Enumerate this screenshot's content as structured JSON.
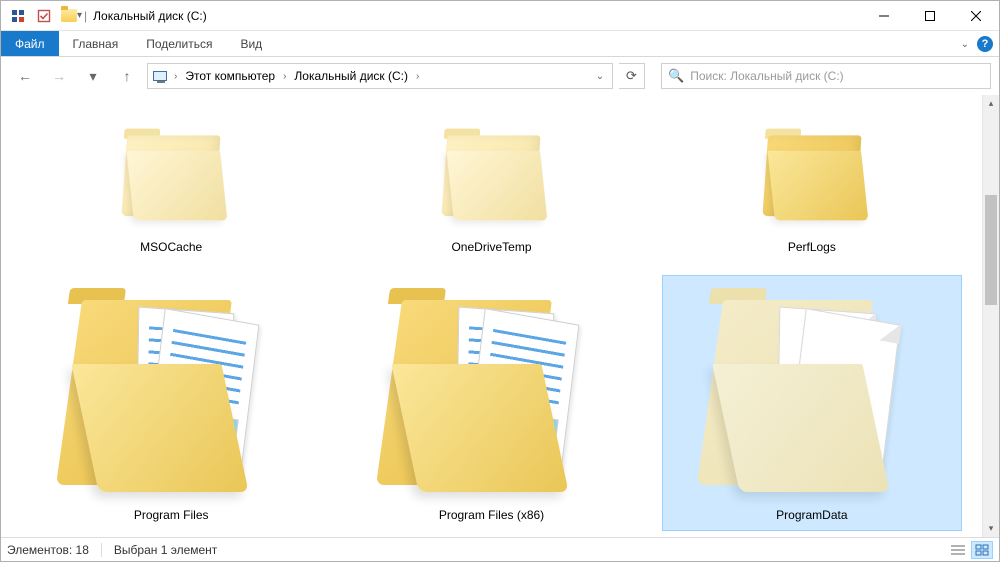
{
  "title": "Локальный диск (C:)",
  "ribbon": {
    "file": "Файл",
    "tabs": [
      "Главная",
      "Поделиться",
      "Вид"
    ]
  },
  "breadcrumb": {
    "root": "Этот компьютер",
    "current": "Локальный диск (C:)"
  },
  "search": {
    "placeholder": "Поиск: Локальный диск (C:)"
  },
  "items": [
    {
      "name": "MSOCache",
      "kind": "empty",
      "selected": false
    },
    {
      "name": "OneDriveTemp",
      "kind": "empty",
      "selected": false
    },
    {
      "name": "PerfLogs",
      "kind": "plain",
      "selected": false
    },
    {
      "name": "Program Files",
      "kind": "docs",
      "selected": false
    },
    {
      "name": "Program Files (x86)",
      "kind": "docs",
      "selected": false
    },
    {
      "name": "ProgramData",
      "kind": "docs",
      "selected": true
    }
  ],
  "status": {
    "count_label": "Элементов: 18",
    "selection_label": "Выбран 1 элемент"
  }
}
